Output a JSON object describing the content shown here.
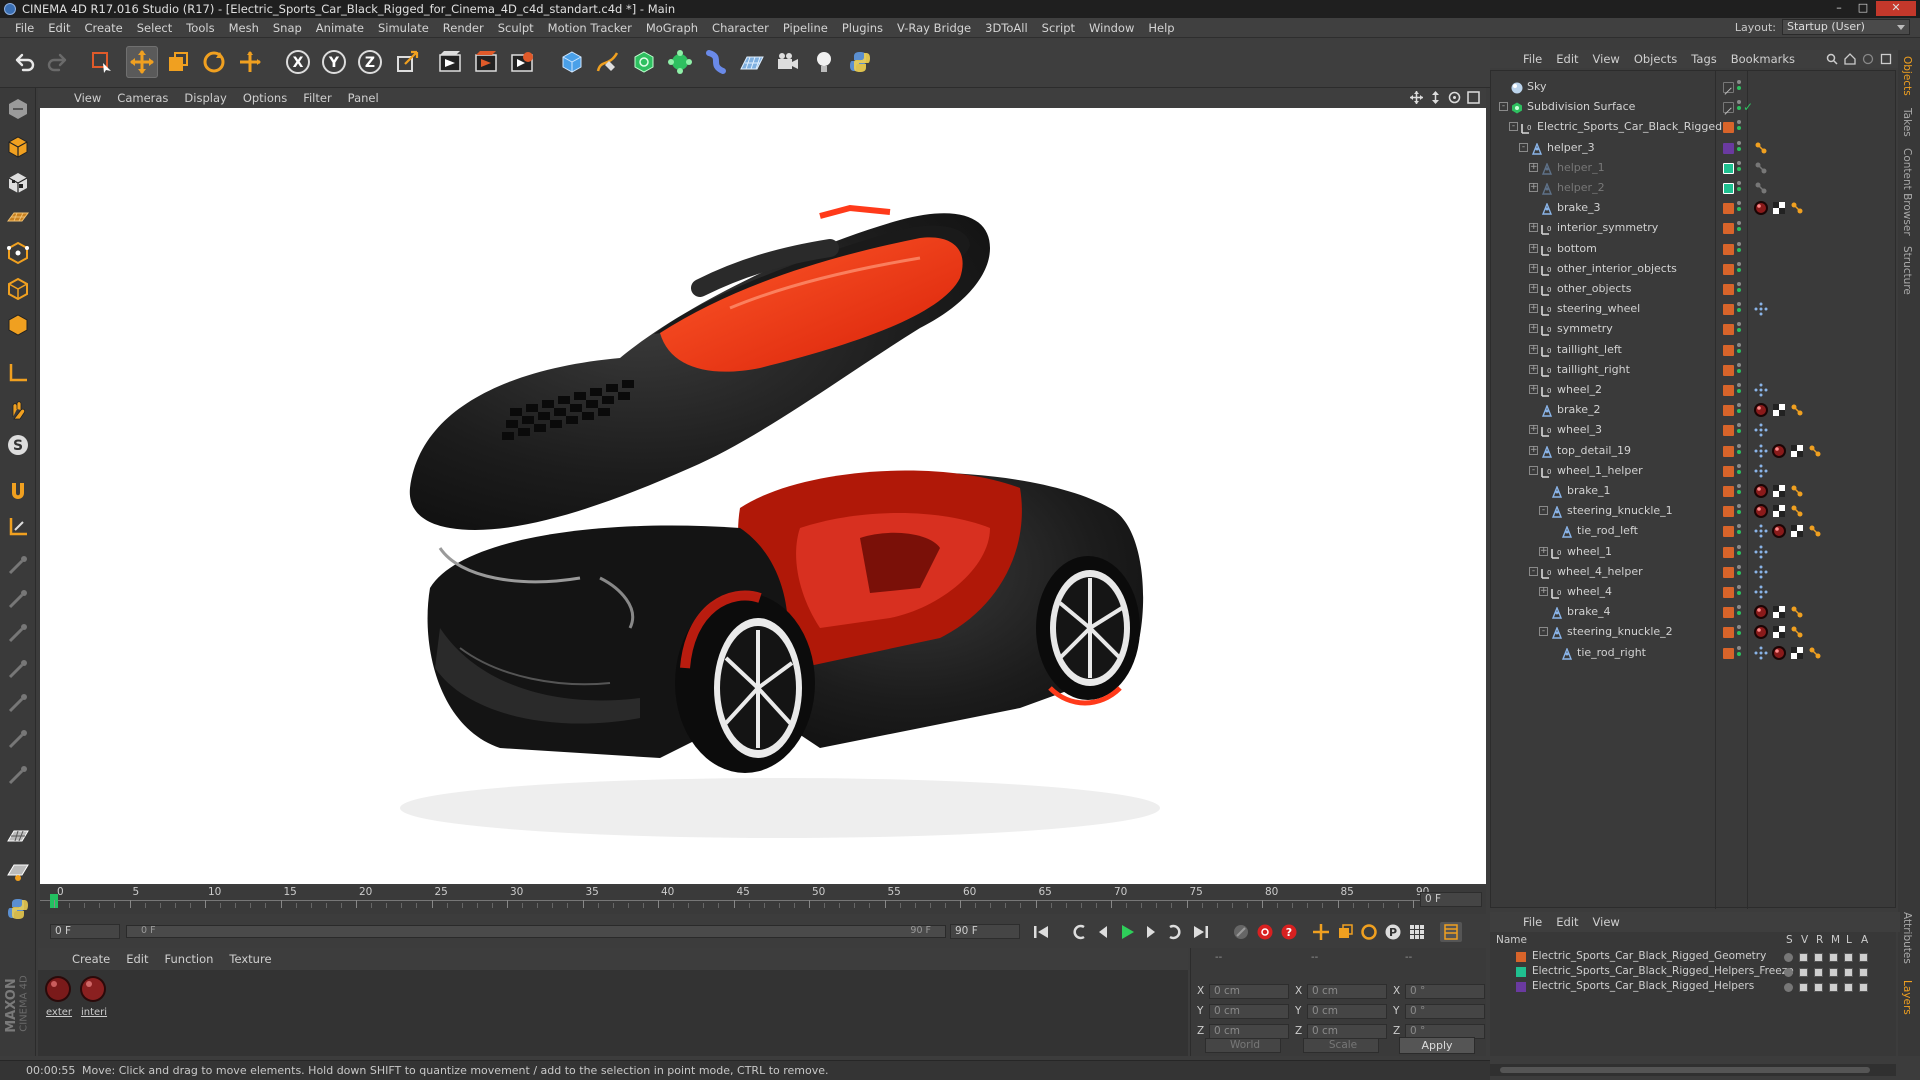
{
  "window": {
    "title": "CINEMA 4D R17.016 Studio (R17) - [Electric_Sports_Car_Black_Rigged_for_Cinema_4D_c4d_standart.c4d *] - Main"
  },
  "menubar": {
    "items": [
      "File",
      "Edit",
      "Create",
      "Select",
      "Tools",
      "Mesh",
      "Snap",
      "Animate",
      "Simulate",
      "Render",
      "Sculpt",
      "Motion Tracker",
      "MoGraph",
      "Character",
      "Pipeline",
      "Plugins",
      "V-Ray Bridge",
      "3DToAll",
      "Script",
      "Window",
      "Help"
    ],
    "layout_label": "Layout:",
    "layout_value": "Startup (User)"
  },
  "viewport": {
    "menu": [
      "View",
      "Cameras",
      "Display",
      "Options",
      "Filter",
      "Panel"
    ]
  },
  "timeline": {
    "ticks": [
      "0",
      "5",
      "10",
      "15",
      "20",
      "25",
      "30",
      "35",
      "40",
      "45",
      "50",
      "55",
      "60",
      "65",
      "70",
      "75",
      "80",
      "85",
      "90"
    ],
    "current_frame": "0 F",
    "start_field": "0 F",
    "range_start": "0 F",
    "range_end": "90 F",
    "end_field": "90 F"
  },
  "materials": {
    "menu": [
      "Create",
      "Edit",
      "Function",
      "Texture"
    ],
    "items": [
      {
        "label": "exter"
      },
      {
        "label": "interi"
      }
    ]
  },
  "coordinates": {
    "header_left": "--",
    "header_mid": "--",
    "header_right": "--",
    "rows": [
      {
        "a": "X",
        "av": "0 cm",
        "b": "X",
        "bv": "0 cm",
        "c": "X",
        "cv": "0 °"
      },
      {
        "a": "Y",
        "av": "0 cm",
        "b": "Y",
        "bv": "0 cm",
        "c": "Y",
        "cv": "0 °"
      },
      {
        "a": "Z",
        "av": "0 cm",
        "b": "Z",
        "bv": "0 cm",
        "c": "Z",
        "cv": "0 °"
      }
    ],
    "mode1": "World",
    "mode2": "Scale",
    "apply": "Apply"
  },
  "object_manager": {
    "menu": [
      "File",
      "Edit",
      "View",
      "Objects",
      "Tags",
      "Bookmarks"
    ],
    "objects": [
      {
        "name": "Sky",
        "indent": 0,
        "type": "sky",
        "expander": "",
        "dim": false,
        "swatch": "#3a3a3a",
        "tags": []
      },
      {
        "name": "Subdivision Surface",
        "indent": 0,
        "type": "subd",
        "expander": "-",
        "dim": false,
        "swatch": "#3a3a3a",
        "tags": []
      },
      {
        "name": "Electric_Sports_Car_Black_Rigged",
        "indent": 1,
        "type": "null",
        "expander": "-",
        "dim": false,
        "swatch": "#d8642a",
        "tags": []
      },
      {
        "name": "helper_3",
        "indent": 2,
        "type": "joint",
        "expander": "-",
        "dim": false,
        "swatch": "#6a3aa0",
        "tags": [
          "ik"
        ]
      },
      {
        "name": "helper_1",
        "indent": 3,
        "type": "joint",
        "expander": "+",
        "dim": true,
        "swatch": "#20c090",
        "tags": [
          "ikdim"
        ]
      },
      {
        "name": "helper_2",
        "indent": 3,
        "type": "joint",
        "expander": "+",
        "dim": true,
        "swatch": "#20c090",
        "tags": [
          "ikdim"
        ]
      },
      {
        "name": "brake_3",
        "indent": 3,
        "type": "joint",
        "expander": "",
        "dim": false,
        "swatch": "#d8642a",
        "tags": [
          "mat",
          "chk",
          "ik"
        ]
      },
      {
        "name": "interior_symmetry",
        "indent": 3,
        "type": "null",
        "expander": "+",
        "dim": false,
        "swatch": "#d8642a",
        "tags": []
      },
      {
        "name": "bottom",
        "indent": 3,
        "type": "null",
        "expander": "+",
        "dim": false,
        "swatch": "#d8642a",
        "tags": []
      },
      {
        "name": "other_interior_objects",
        "indent": 3,
        "type": "null",
        "expander": "+",
        "dim": false,
        "swatch": "#d8642a",
        "tags": []
      },
      {
        "name": "other_objects",
        "indent": 3,
        "type": "null",
        "expander": "+",
        "dim": false,
        "swatch": "#d8642a",
        "tags": []
      },
      {
        "name": "steering_wheel",
        "indent": 3,
        "type": "null",
        "expander": "+",
        "dim": false,
        "swatch": "#d8642a",
        "tags": [
          "xp"
        ]
      },
      {
        "name": "symmetry",
        "indent": 3,
        "type": "null",
        "expander": "+",
        "dim": false,
        "swatch": "#d8642a",
        "tags": []
      },
      {
        "name": "taillight_left",
        "indent": 3,
        "type": "null",
        "expander": "+",
        "dim": false,
        "swatch": "#d8642a",
        "tags": []
      },
      {
        "name": "taillight_right",
        "indent": 3,
        "type": "null",
        "expander": "+",
        "dim": false,
        "swatch": "#d8642a",
        "tags": []
      },
      {
        "name": "wheel_2",
        "indent": 3,
        "type": "null",
        "expander": "+",
        "dim": false,
        "swatch": "#d8642a",
        "tags": [
          "xp"
        ]
      },
      {
        "name": "brake_2",
        "indent": 3,
        "type": "joint",
        "expander": "",
        "dim": false,
        "swatch": "#d8642a",
        "tags": [
          "mat",
          "chk",
          "ik"
        ]
      },
      {
        "name": "wheel_3",
        "indent": 3,
        "type": "null",
        "expander": "+",
        "dim": false,
        "swatch": "#d8642a",
        "tags": [
          "xp"
        ]
      },
      {
        "name": "top_detail_19",
        "indent": 3,
        "type": "joint",
        "expander": "+",
        "dim": false,
        "swatch": "#d8642a",
        "tags": [
          "xp",
          "mat",
          "chk",
          "ik"
        ]
      },
      {
        "name": "wheel_1_helper",
        "indent": 3,
        "type": "null",
        "expander": "-",
        "dim": false,
        "swatch": "#d8642a",
        "tags": [
          "xp"
        ]
      },
      {
        "name": "brake_1",
        "indent": 4,
        "type": "joint",
        "expander": "",
        "dim": false,
        "swatch": "#d8642a",
        "tags": [
          "mat",
          "chk",
          "ik"
        ]
      },
      {
        "name": "steering_knuckle_1",
        "indent": 4,
        "type": "joint",
        "expander": "-",
        "dim": false,
        "swatch": "#d8642a",
        "tags": [
          "mat",
          "chk",
          "ik"
        ]
      },
      {
        "name": "tie_rod_left",
        "indent": 5,
        "type": "joint",
        "expander": "",
        "dim": false,
        "swatch": "#d8642a",
        "tags": [
          "xp",
          "mat",
          "chk",
          "ik"
        ]
      },
      {
        "name": "wheel_1",
        "indent": 4,
        "type": "null",
        "expander": "+",
        "dim": false,
        "swatch": "#d8642a",
        "tags": [
          "xp"
        ]
      },
      {
        "name": "wheel_4_helper",
        "indent": 3,
        "type": "null",
        "expander": "-",
        "dim": false,
        "swatch": "#d8642a",
        "tags": [
          "xp"
        ]
      },
      {
        "name": "wheel_4",
        "indent": 4,
        "type": "null",
        "expander": "+",
        "dim": false,
        "swatch": "#d8642a",
        "tags": [
          "xp"
        ]
      },
      {
        "name": "brake_4",
        "indent": 4,
        "type": "joint",
        "expander": "",
        "dim": false,
        "swatch": "#d8642a",
        "tags": [
          "mat",
          "chk",
          "ik"
        ]
      },
      {
        "name": "steering_knuckle_2",
        "indent": 4,
        "type": "joint",
        "expander": "-",
        "dim": false,
        "swatch": "#d8642a",
        "tags": [
          "mat",
          "chk",
          "ik"
        ]
      },
      {
        "name": "tie_rod_right",
        "indent": 5,
        "type": "joint",
        "expander": "",
        "dim": false,
        "swatch": "#d8642a",
        "tags": [
          "xp",
          "mat",
          "chk",
          "ik"
        ]
      }
    ]
  },
  "right_tabs": [
    "Objects",
    "Takes",
    "Content Browser",
    "Structure",
    "Attributes",
    "Layers"
  ],
  "layers": {
    "menu": [
      "File",
      "Edit",
      "View"
    ],
    "header": {
      "name": "Name",
      "cols": [
        "S",
        "V",
        "R",
        "M",
        "L",
        "A"
      ]
    },
    "items": [
      {
        "name": "Electric_Sports_Car_Black_Rigged_Geometry",
        "color": "#d8642a"
      },
      {
        "name": "Electric_Sports_Car_Black_Rigged_Helpers_Freeze",
        "color": "#20c090"
      },
      {
        "name": "Electric_Sports_Car_Black_Rigged_Helpers",
        "color": "#6a3aa0"
      }
    ]
  },
  "status": {
    "time": "00:00:55",
    "message": "Move: Click and drag to move elements. Hold down SHIFT to quantize movement / add to the selection in point mode, CTRL to remove."
  },
  "branding": {
    "maxon": "MAXON",
    "product": "CINEMA 4D"
  },
  "colors": {
    "accent_blue": "#3a7fd5",
    "car_red": "#ff3a1a",
    "layer_orange": "#d8642a",
    "layer_green": "#20c090",
    "layer_purple": "#6a3aa0"
  }
}
